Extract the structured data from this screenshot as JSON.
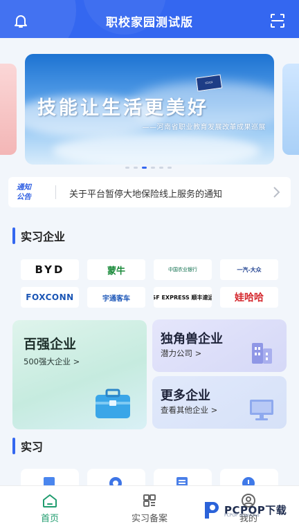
{
  "header": {
    "title": "职校家园测试版"
  },
  "banner": {
    "slogan": "技能让生活更美好",
    "subtitle": "——河南省职业教育发展改革成果巡展",
    "dots_total": 6,
    "active_index": 3
  },
  "notice": {
    "tag_line1": "通知",
    "tag_line2": "公告",
    "text": "关于平台暂停大地保险线上服务的通知"
  },
  "internship_companies": {
    "section_title": "实习企业",
    "logos": [
      {
        "text": "BYD"
      },
      {
        "text": "蒙牛"
      },
      {
        "text": "中国农业银行"
      },
      {
        "text": "一汽-大众"
      },
      {
        "text": "FOXCONN"
      },
      {
        "text": "宇通客车"
      },
      {
        "text": "SF EXPRESS 顺丰速运"
      },
      {
        "text": "娃哈哈"
      }
    ]
  },
  "categories": {
    "top100": {
      "title": "百强企业",
      "sub": "500强大企业 >"
    },
    "unicorn": {
      "title": "独角兽企业",
      "sub": "潜力公司 >"
    },
    "more": {
      "title": "更多企业",
      "sub": "查看其他企业 >"
    }
  },
  "internship": {
    "section_title": "实习"
  },
  "tabbar": {
    "home": "首页",
    "record": "实习备案",
    "me": "我的"
  },
  "watermark": {
    "brand": "PCPOP下载",
    "tagline": "PCPOP download"
  },
  "colors": {
    "primary": "#3467f0",
    "active_tab": "#1f9c6e"
  }
}
